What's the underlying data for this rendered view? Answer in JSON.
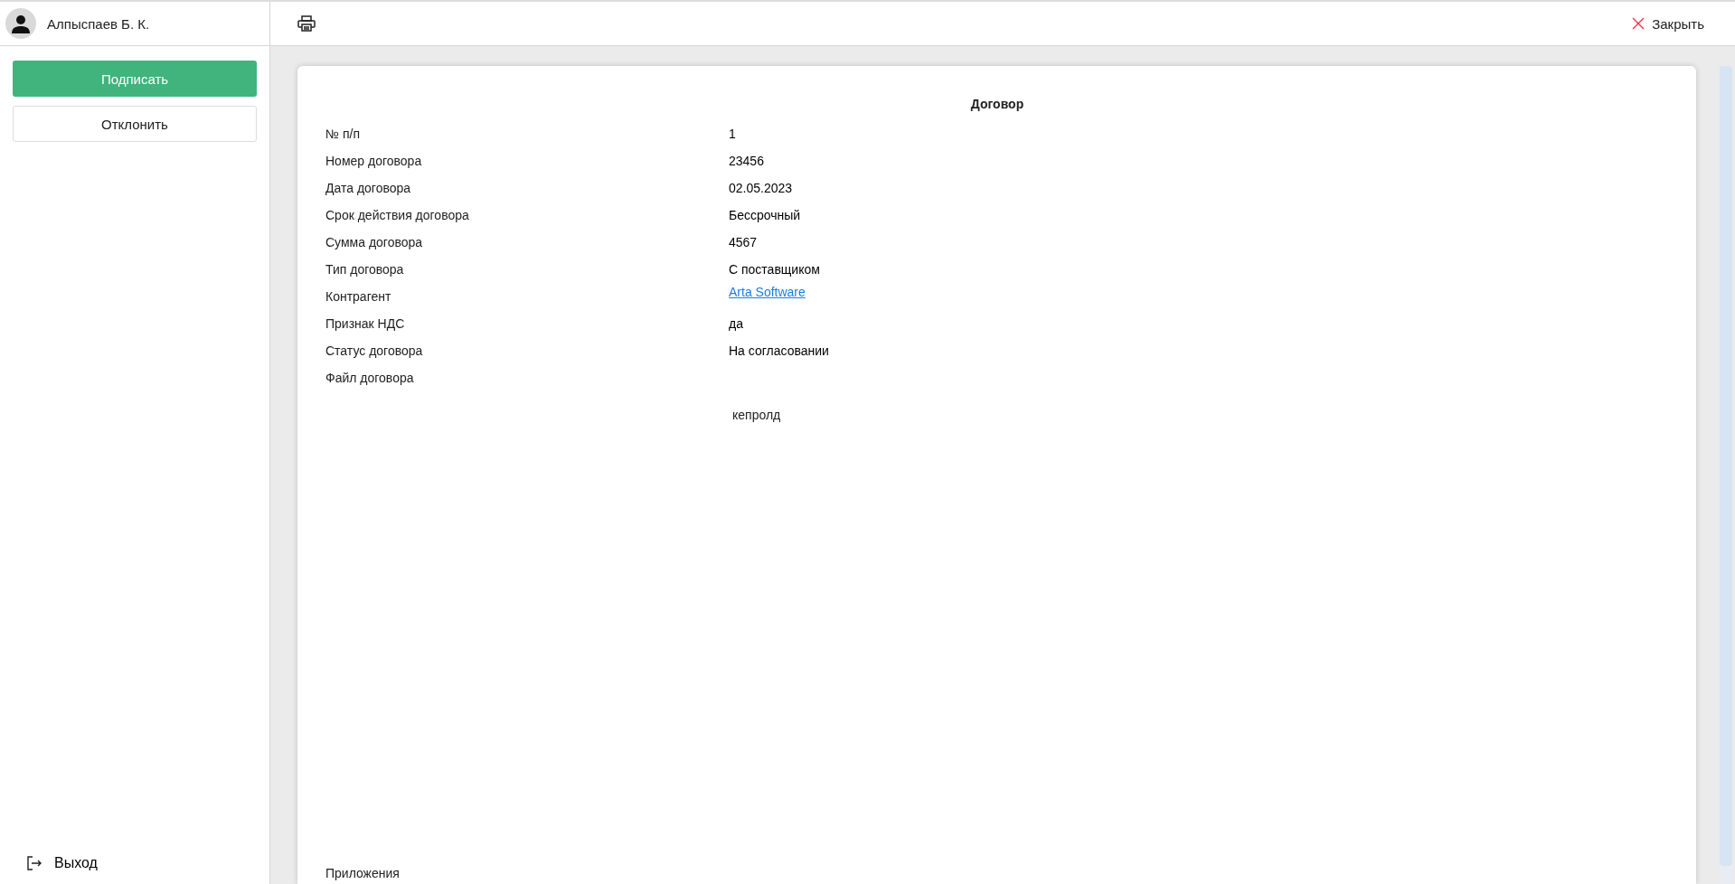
{
  "user": {
    "name": "Алпыспаев Б. К."
  },
  "actions": [
    {
      "label": "Подписать",
      "kind": "primary"
    },
    {
      "label": "Отклонить",
      "kind": "secondary"
    }
  ],
  "logout": {
    "label": "Выход"
  },
  "toolbar": {
    "close": "Закрыть"
  },
  "document": {
    "title": "Договор",
    "fields": [
      {
        "label": "№ п/п",
        "value": "1",
        "kind": "text"
      },
      {
        "label": "Номер договора",
        "value": "23456",
        "kind": "text"
      },
      {
        "label": "Дата договора",
        "value": "02.05.2023",
        "kind": "text"
      },
      {
        "label": "Срок действия договора",
        "value": "Бессрочный",
        "kind": "text"
      },
      {
        "label": "Сумма договора",
        "value": "4567",
        "kind": "text"
      },
      {
        "label": "Тип договора",
        "value": "С поставщиком",
        "kind": "text"
      },
      {
        "label": "Контрагент",
        "value": "Arta Software",
        "kind": "link"
      },
      {
        "label": "Признак НДС",
        "value": "да",
        "kind": "text"
      },
      {
        "label": "Статус договора",
        "value": "На согласовании",
        "kind": "text"
      },
      {
        "label": "Файл договора"
      }
    ],
    "file_name": "кепролд",
    "attachments_label": "Приложения"
  }
}
